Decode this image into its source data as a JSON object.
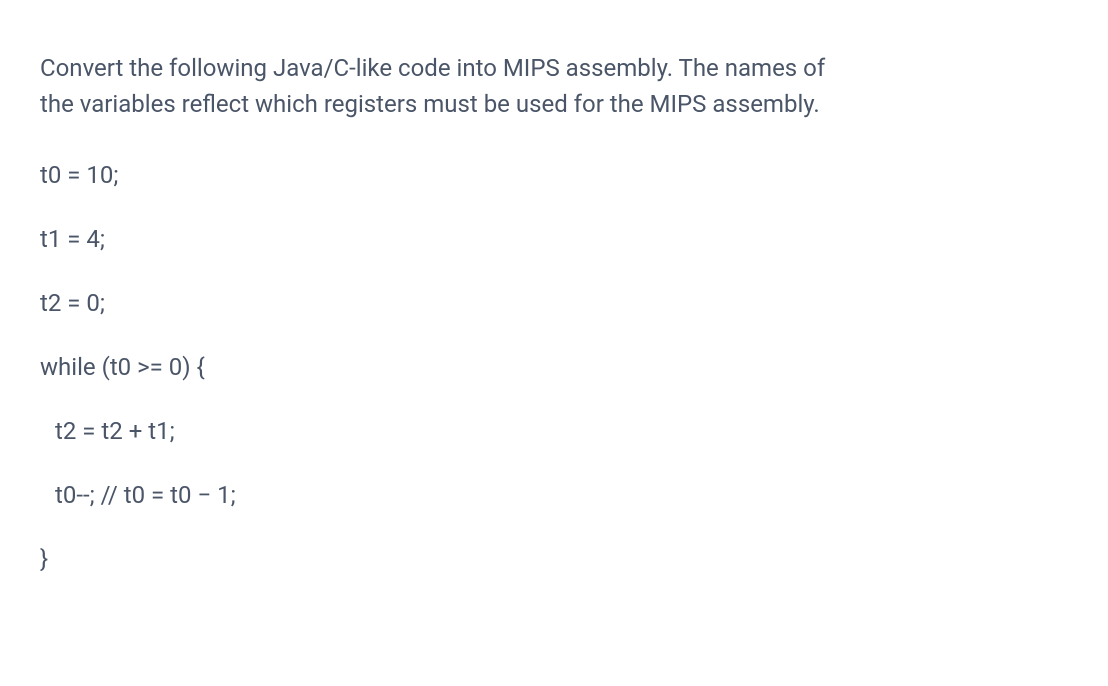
{
  "prompt": {
    "line1": "Convert the following Java/C-like code into MIPS assembly. The names of",
    "line2": "the variables reflect which registers must be used for the MIPS assembly."
  },
  "code": {
    "line1": "t0 = 10;",
    "line2": "t1 = 4;",
    "line3": "t2 = 0;",
    "line4": "while (t0 >= 0) {",
    "line5": "t2 = t2 + t1;",
    "line6": "t0--;  // t0 = t0 − 1;",
    "line7": "}"
  }
}
